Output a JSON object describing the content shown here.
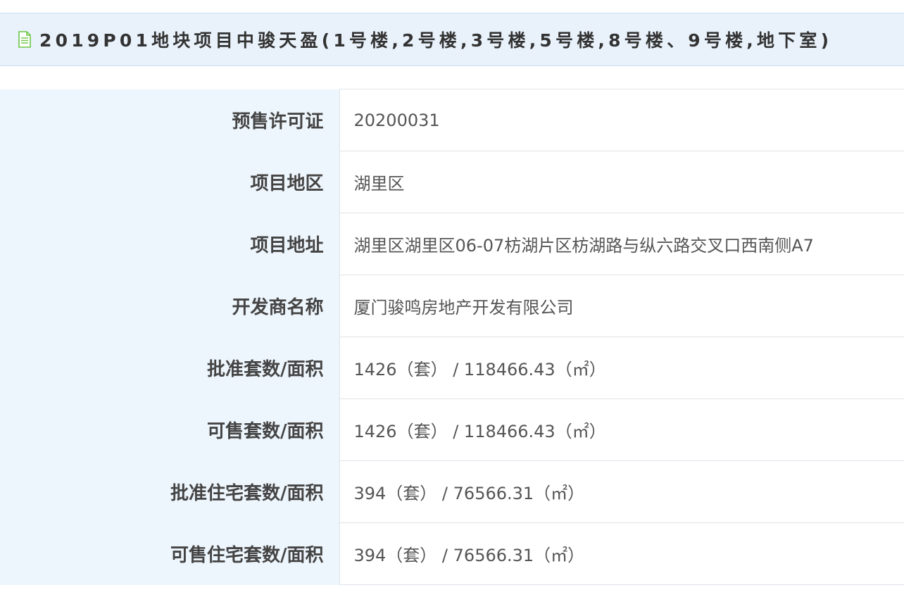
{
  "header": {
    "icon": "document-icon",
    "title": "2019P01地块项目中骏天盈(1号楼,2号楼,3号楼,5号楼,8号楼、9号楼,地下室)"
  },
  "details": {
    "rows": [
      {
        "label": "预售许可证",
        "value": "20200031"
      },
      {
        "label": "项目地区",
        "value": "湖里区"
      },
      {
        "label": "项目地址",
        "value": "湖里区湖里区06-07枋湖片区枋湖路与纵六路交叉口西南侧A7"
      },
      {
        "label": "开发商名称",
        "value": "厦门骏鸣房地产开发有限公司"
      },
      {
        "label": "批准套数/面积",
        "value": "1426（套） / 118466.43（㎡）"
      },
      {
        "label": "可售套数/面积",
        "value": "1426（套） / 118466.43（㎡）"
      },
      {
        "label": "批准住宅套数/面积",
        "value": "394（套） / 76566.31（㎡）"
      },
      {
        "label": "可售住宅套数/面积",
        "value": "394（套） / 76566.31（㎡）"
      }
    ]
  },
  "colors": {
    "title_bg": "#e9f2fb",
    "label_bg": "#eef6fd",
    "icon_green": "#6cc644",
    "border": "#dfe3e8"
  }
}
